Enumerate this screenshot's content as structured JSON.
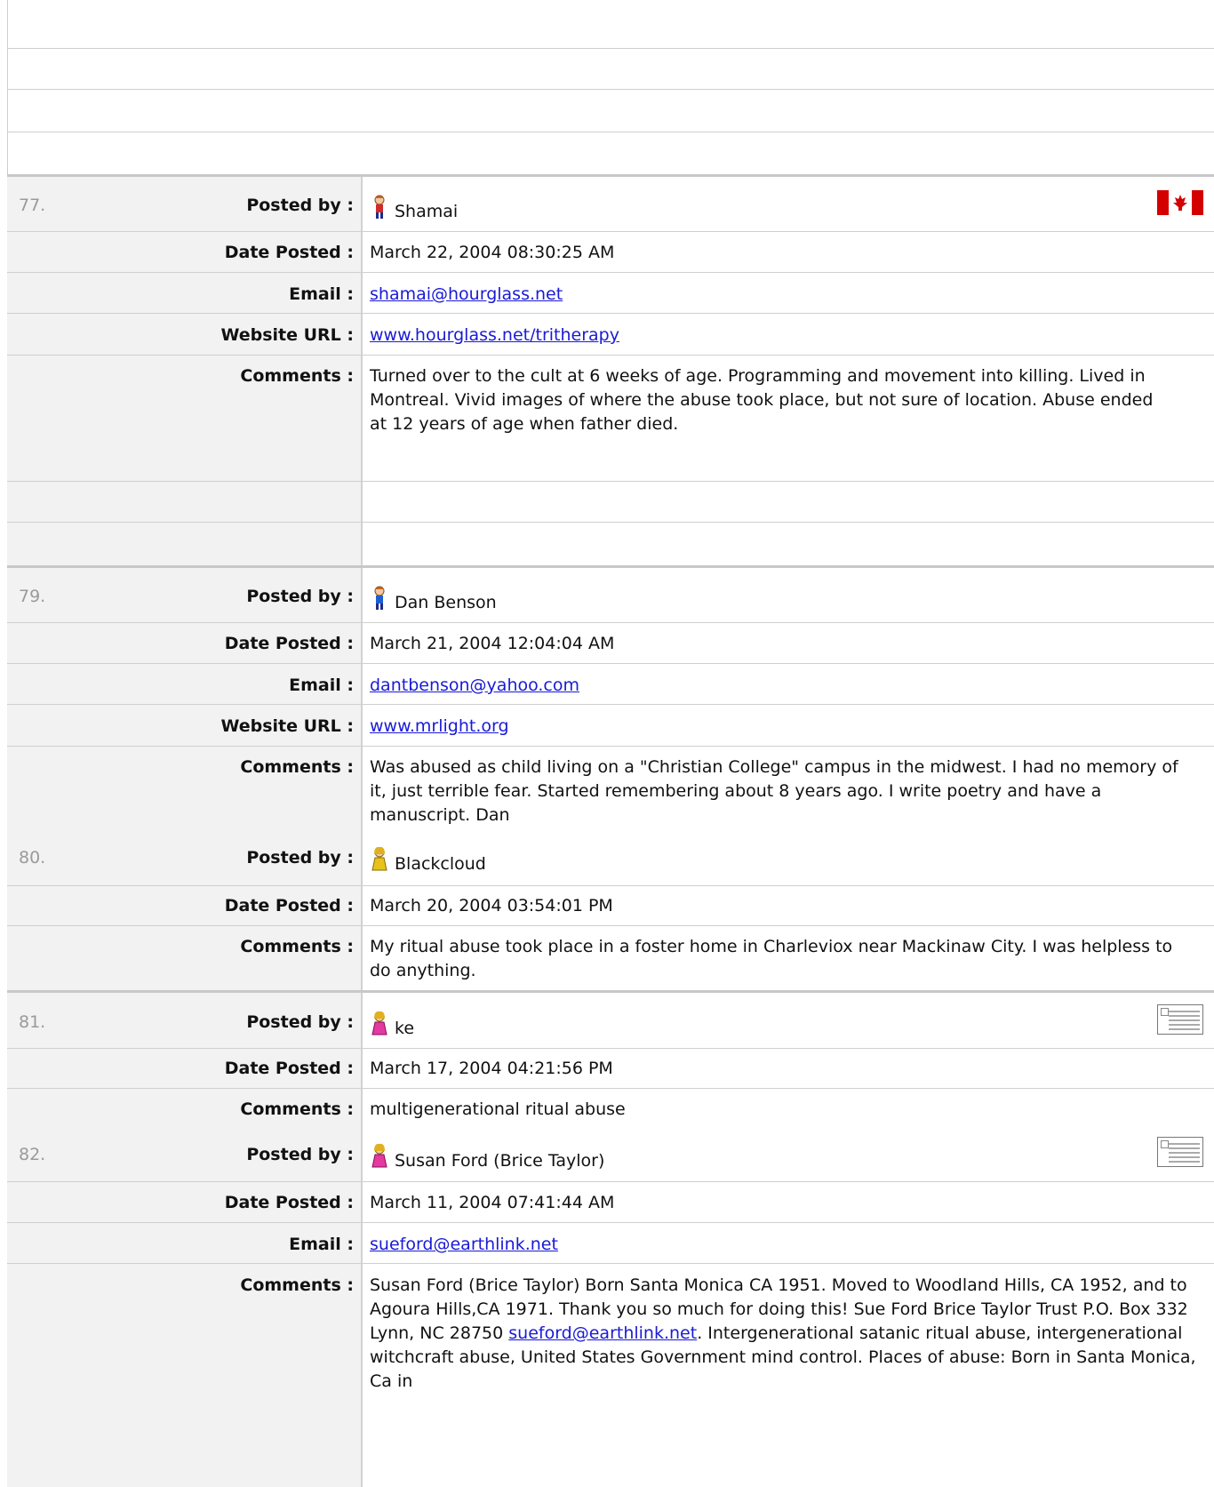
{
  "entries": {
    "e77": {
      "number": "77.",
      "posted_by_label": "Posted by :",
      "name": "Shamai",
      "date_label": "Date Posted :",
      "date": "March 22, 2004 08:30:25 AM",
      "email_label": "Email :",
      "email": "shamai@hourglass.net",
      "website_label": "Website URL :",
      "website": "www.hourglass.net/tritherapy",
      "comments_label": "Comments :",
      "comments": "Turned over to the cult at 6 weeks of age. Programming and movement into killing. Lived in Montreal. Vivid images of where the abuse took place, but not sure of location. Abuse ended at 12 years of age when father died.",
      "flag": "canada-flag-icon"
    },
    "e79": {
      "number": "79.",
      "posted_by_label": "Posted by :",
      "name": "Dan Benson",
      "date_label": "Date Posted :",
      "date": "March 21, 2004 12:04:04 AM",
      "email_label": "Email :",
      "email": "dantbenson@yahoo.com",
      "website_label": "Website URL :",
      "website": "www.mrlight.org",
      "comments_label": "Comments :",
      "comments": "Was abused as child living on a \"Christian College\" campus in the midwest. I had no memory of it, just terrible fear. Started remembering about 8 years ago. I write poetry and have a manuscript. Dan"
    },
    "e80": {
      "number": "80.",
      "posted_by_label": "Posted by :",
      "name": "Blackcloud",
      "date_label": "Date Posted :",
      "date": "March 20, 2004 03:54:01 PM",
      "comments_label": "Comments :",
      "comments": "My ritual abuse took place in a foster home in Charleviox near Mackinaw City. I was helpless to do anything."
    },
    "e81": {
      "number": "81.",
      "posted_by_label": "Posted by :",
      "name": "ke",
      "date_label": "Date Posted :",
      "date": "March 17, 2004 04:21:56 PM",
      "comments_label": "Comments :",
      "comments": "multigenerational ritual abuse"
    },
    "e82": {
      "number": "82.",
      "posted_by_label": "Posted by :",
      "name": "Susan Ford (Brice Taylor)",
      "date_label": "Date Posted :",
      "date": "March 11, 2004 07:41:44 AM",
      "email_label": "Email :",
      "email": "sueford@earthlink.net",
      "comments_label": "Comments :",
      "comments_text": "Susan Ford (Brice Taylor) Born Santa Monica CA 1951. Moved to Woodland Hills, CA 1952, and to Agoura Hills,CA 1971. Thank you so much for doing this! Sue Ford Brice Taylor Trust P.O. Box 332 Lynn, NC 28750 ",
      "comments_link": "sueford@earthlink.net",
      "comments_text_2": ". Intergenerational satanic ritual abuse, intergenerational witchcraft abuse, United States Government mind control. Places of abuse: Born in Santa Monica, Ca in"
    }
  },
  "colors": {
    "label_bg": "#f2f2f2",
    "link": "#1a1ad6",
    "number": "#9a9a9a",
    "divider": "#cfcfcf"
  }
}
